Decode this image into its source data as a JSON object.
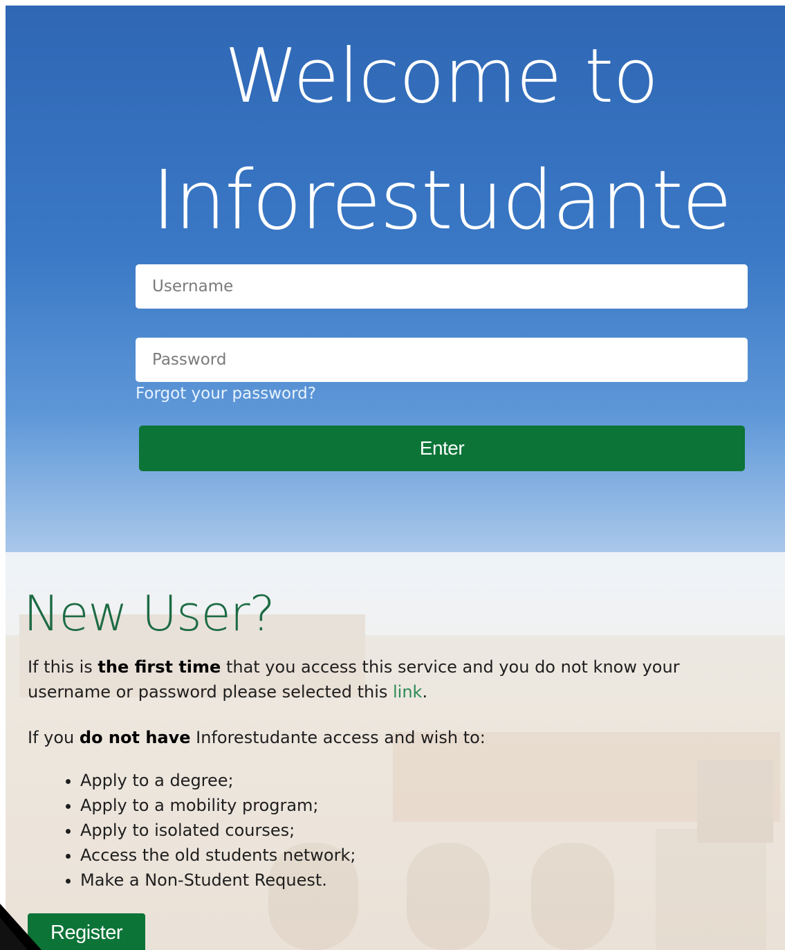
{
  "hero": {
    "title_line1": "Welcome to",
    "title_line2": "Inforestudante"
  },
  "login": {
    "username_placeholder": "Username",
    "password_placeholder": "Password",
    "forgot_label": "Forgot your password?",
    "enter_label": "Enter"
  },
  "new_user": {
    "title": "New User?",
    "p1_before": "If this is ",
    "p1_bold": "the first time",
    "p1_after": " that you access this service and you do not know your username or password please selected this ",
    "p1_link": "link",
    "p1_end": ".",
    "p2_before": "If you ",
    "p2_bold": "do not have",
    "p2_after": " Inforestudante access and wish to:",
    "items": [
      "Apply to a degree;",
      "Apply to a mobility program;",
      "Apply to isolated courses;",
      "Access the old students network;",
      "Make a Non-Student Request."
    ],
    "register_label": "Register"
  },
  "colors": {
    "hero_blue": "#3a78c6",
    "brand_green": "#0c7437",
    "title_green": "#1d6b43"
  }
}
